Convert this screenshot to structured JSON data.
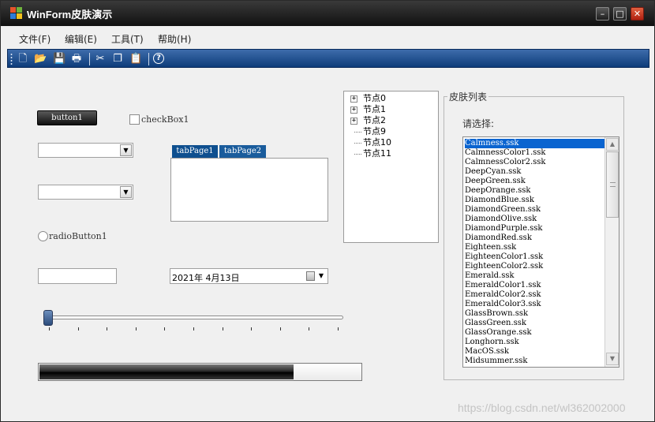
{
  "window": {
    "title": "WinForm皮肤演示",
    "minimize_glyph": "–",
    "maximize_glyph": "□",
    "close_glyph": "✕"
  },
  "menu": [
    "文件(F)",
    "编辑(E)",
    "工具(T)",
    "帮助(H)"
  ],
  "toolbar": {
    "icons": [
      "new-file-icon",
      "open-folder-icon",
      "save-icon",
      "print-icon",
      "cut-icon",
      "copy-icon",
      "paste-icon",
      "help-icon"
    ],
    "glyphs": [
      "🗋",
      "📂",
      "💾",
      "🖶",
      "✂",
      "❐",
      "📋",
      "?"
    ]
  },
  "controls": {
    "button1": "button1",
    "checkbox1": "checkBox1",
    "radio1": "radioButton1",
    "tabs": [
      "tabPage1",
      "tabPage2"
    ],
    "date_value": "2021年  4月13日",
    "combo_arrow": "▼",
    "progress_value_percent": 79,
    "slider_value": 0,
    "slider_max": 10
  },
  "tree": [
    {
      "label": "节点0",
      "expandable": true
    },
    {
      "label": "节点1",
      "expandable": true
    },
    {
      "label": "节点2",
      "expandable": true
    },
    {
      "label": "节点9",
      "expandable": false
    },
    {
      "label": "节点10",
      "expandable": false
    },
    {
      "label": "节点11",
      "expandable": false
    }
  ],
  "skin_panel": {
    "title": "皮肤列表",
    "prompt": "请选择:",
    "selected_index": 0,
    "items": [
      "Calmness.ssk",
      "CalmnessColor1.ssk",
      "CalmnessColor2.ssk",
      "DeepCyan.ssk",
      "DeepGreen.ssk",
      "DeepOrange.ssk",
      "DiamondBlue.ssk",
      "DiamondGreen.ssk",
      "DiamondOlive.ssk",
      "DiamondPurple.ssk",
      "DiamondRed.ssk",
      "Eighteen.ssk",
      "EighteenColor1.ssk",
      "EighteenColor2.ssk",
      "Emerald.ssk",
      "EmeraldColor1.ssk",
      "EmeraldColor2.ssk",
      "EmeraldColor3.ssk",
      "GlassBrown.ssk",
      "GlassGreen.ssk",
      "GlassOrange.ssk",
      "Longhorn.ssk",
      "MacOS.ssk",
      "Midsummer.ssk"
    ]
  },
  "watermark": "https://blog.csdn.net/wl362002000",
  "colors": {
    "toolbar_blue": "#0e3c7a",
    "tab_blue": "#0e4f8f",
    "selection_blue": "#0a64d0",
    "close_red": "#c02a14"
  }
}
